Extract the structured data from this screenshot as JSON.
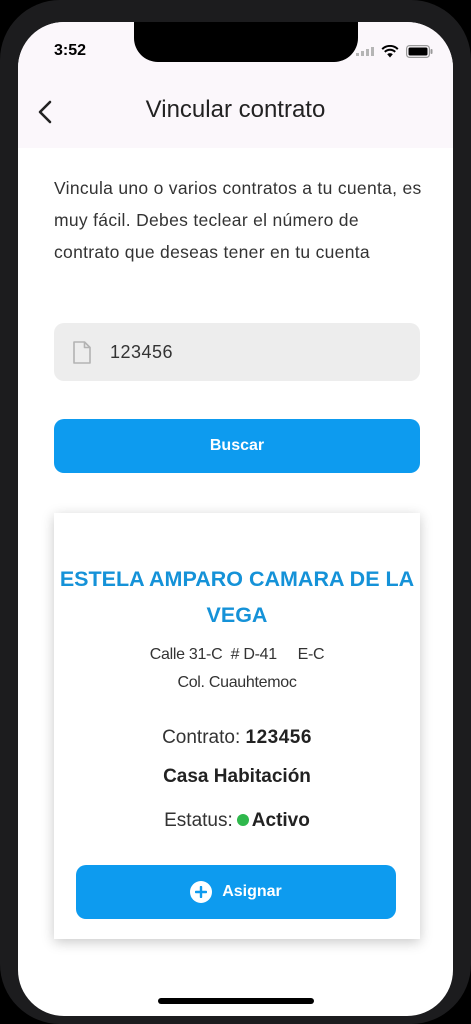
{
  "status_bar": {
    "time": "3:52"
  },
  "nav": {
    "title": "Vincular contrato"
  },
  "intro": {
    "text": "Vincula uno o varios contratos a tu cuenta, es muy fácil. Debes teclear el número de contrato que deseas tener en tu cuenta"
  },
  "search": {
    "value": "123456",
    "button_label": "Buscar"
  },
  "card": {
    "name": "ESTELA AMPARO CAMARA DE LA VEGA",
    "address_line1": "Calle 31-C  # D-41     E-C",
    "address_line2": "Col. Cuauhtemoc",
    "contract_label": "Contrato:",
    "contract_number": "123456",
    "property_type": "Casa Habitación",
    "status_label": "Estatus:",
    "status_value": "Activo",
    "assign_label": "Asignar"
  },
  "colors": {
    "accent": "#0d9bef",
    "name_text": "#1592d8",
    "status_active": "#2fb84c"
  },
  "icons": {
    "back": "chevron-left-icon",
    "field": "document-icon",
    "assign": "plus-circle-icon"
  }
}
